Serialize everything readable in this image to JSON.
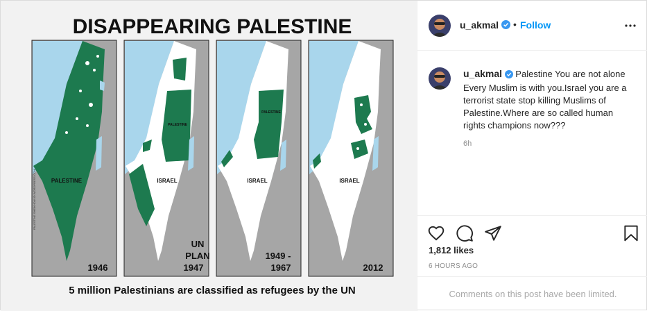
{
  "image": {
    "title": "DISAPPEARING PALESTINE",
    "caption": "5 million Palestinians are classified as refugees by the UN",
    "credit": "PALESTINE.SHEIKHDAVID.WORDPRESS.COM",
    "maps": [
      {
        "region_label": "PALESTINE",
        "year_line1": "1946",
        "year_line2": ""
      },
      {
        "region_label": "PALESTINE",
        "region_label2": "ISRAEL",
        "year_line0": "UN",
        "year_line1": "PLAN",
        "year_line2": "1947"
      },
      {
        "region_label": "PALESTINE",
        "region_label2": "ISRAEL",
        "year_line1": "1949 -",
        "year_line2": "1967"
      },
      {
        "region_label2": "ISRAEL",
        "year_line1": "2012",
        "year_line2": ""
      }
    ],
    "colors": {
      "palestine": "#1d7a4f",
      "israel": "#ffffff",
      "sea": "#a9d6ec",
      "neighbors": "#a6a6a6",
      "background": "#f2f2f2"
    }
  },
  "post": {
    "username": "u_akmal",
    "follow_label": "Follow",
    "separator": "•",
    "more_icon": "more-horizontal-icon",
    "caption_user": "u_akmal",
    "caption_text": "Palestine You are not alone Every Muslim is with you.Israel you are a terrorist state stop killing Muslims of Palestine.Where are so called human rights champions now???",
    "caption_time": "6h",
    "likes": "1,812 likes",
    "posted_ago": "6 HOURS AGO",
    "comments_limited": "Comments on this post have been limited.",
    "icons": [
      "heart-icon",
      "comment-icon",
      "share-icon",
      "bookmark-icon"
    ]
  }
}
